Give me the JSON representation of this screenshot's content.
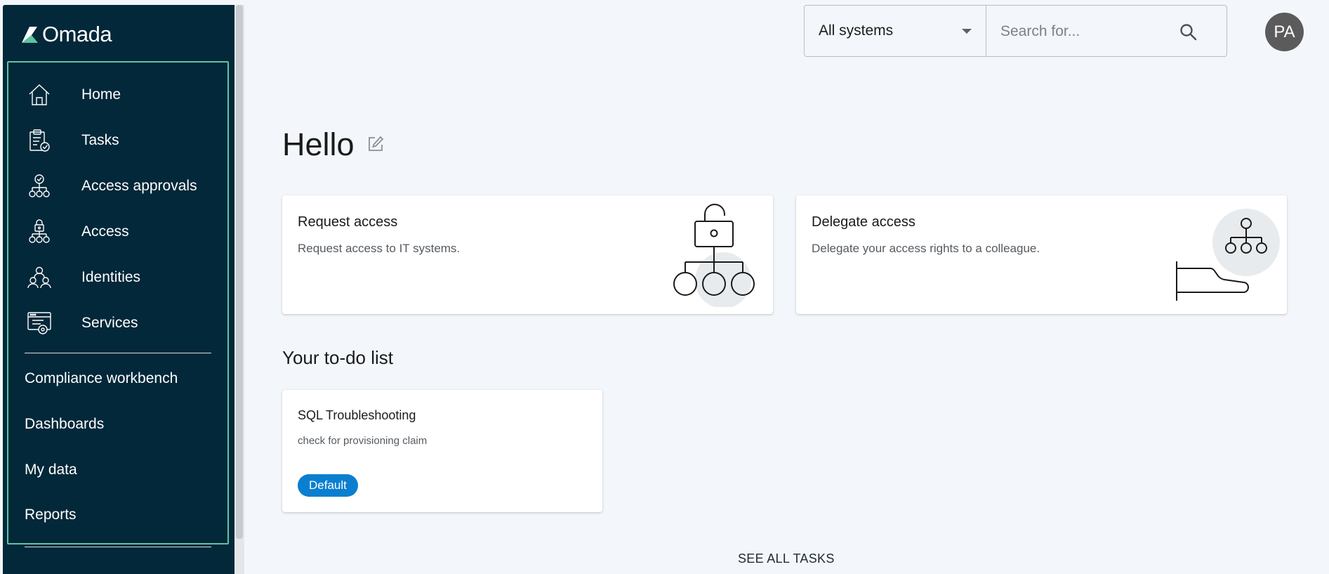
{
  "app": {
    "brand": "Omada"
  },
  "sidebar": {
    "primary": [
      {
        "label": "Home",
        "icon": "home-icon"
      },
      {
        "label": "Tasks",
        "icon": "tasks-clipboard-icon"
      },
      {
        "label": "Access approvals",
        "icon": "access-approvals-icon"
      },
      {
        "label": "Access",
        "icon": "access-lock-icon"
      },
      {
        "label": "Identities",
        "icon": "identities-icon"
      },
      {
        "label": "Services",
        "icon": "services-icon"
      }
    ],
    "secondary": [
      {
        "label": "Compliance workbench"
      },
      {
        "label": "Dashboards"
      },
      {
        "label": "My data"
      },
      {
        "label": "Reports"
      }
    ],
    "accent_color": "#5fc4a0",
    "background_color": "#02283a"
  },
  "topbar": {
    "system_select_value": "All systems",
    "search_placeholder": "Search for...",
    "avatar_initials": "PA"
  },
  "main": {
    "greeting": "Hello",
    "cards": [
      {
        "title": "Request access",
        "description": "Request access to IT systems.",
        "icon": "request-access-illustration"
      },
      {
        "title": "Delegate access",
        "description": "Delegate your access rights to a colleague.",
        "icon": "delegate-access-illustration"
      }
    ],
    "todo": {
      "heading": "Your to-do list",
      "items": [
        {
          "title": "SQL Troubleshooting",
          "description": "check for provisioning claim",
          "badge": "Default"
        }
      ],
      "see_all_label": "SEE ALL TASKS"
    },
    "badge_color": "#0a7fd0"
  }
}
